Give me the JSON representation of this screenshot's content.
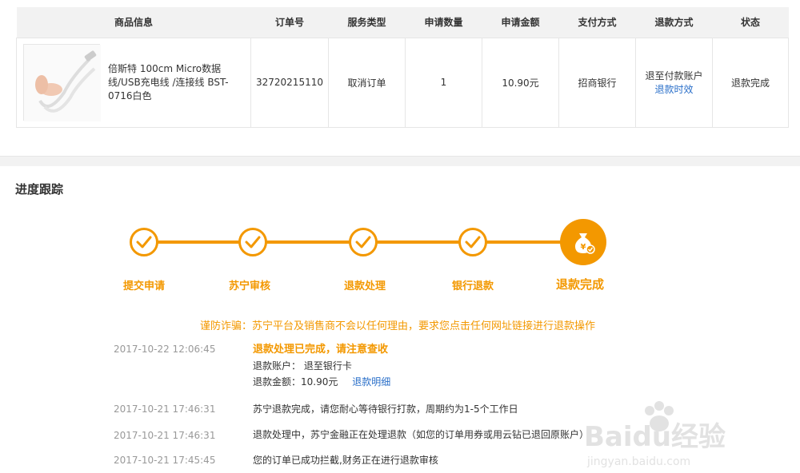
{
  "order_table": {
    "headers": [
      "商品信息",
      "订单号",
      "服务类型",
      "申请数量",
      "申请金额",
      "支付方式",
      "退款方式",
      "状态"
    ],
    "row": {
      "product_name": "倍斯特 100cm Micro数据线/USB充电线 /连接线 BST-0716白色",
      "order_no": "32720215110",
      "service_type": "取消订单",
      "quantity": "1",
      "amount": "10.90元",
      "payment": "招商银行",
      "refund_method": "退至付款账户",
      "refund_link": "退款时效",
      "status": "退款完成"
    }
  },
  "progress": {
    "title": "进度跟踪",
    "steps": [
      "提交申请",
      "苏宁审核",
      "退款处理",
      "银行退款",
      "退款完成"
    ],
    "accent_color": "#f39800",
    "current_step_icon": "money-bag-icon",
    "warning": "谨防诈骗：苏宁平台及销售商不会以任何理由，要求您点击任何网址链接进行退款操作"
  },
  "logs": [
    {
      "time": "2017-10-22 12:06:45",
      "headline": "退款处理已完成，请注意查收",
      "account_label": "退款账户：",
      "account_value": "退至银行卡",
      "amount_label": "退款金额：",
      "amount_value": "10.90元",
      "detail_link": "退款明细"
    },
    {
      "time": "2017-10-21 17:46:31",
      "text": "苏宁退款完成，请您耐心等待银行打款，周期约为1-5个工作日"
    },
    {
      "time": "2017-10-21 17:46:31",
      "text": "退款处理中，苏宁金融正在处理退款（如您的订单用券或用云钻已退回原账户）"
    },
    {
      "time": "2017-10-21 17:45:45",
      "text": "您的订单已成功拦截,财务正在进行退款审核"
    }
  ],
  "watermark": {
    "brand": "Baidu经验",
    "url": "jingyan.baidu.com"
  }
}
